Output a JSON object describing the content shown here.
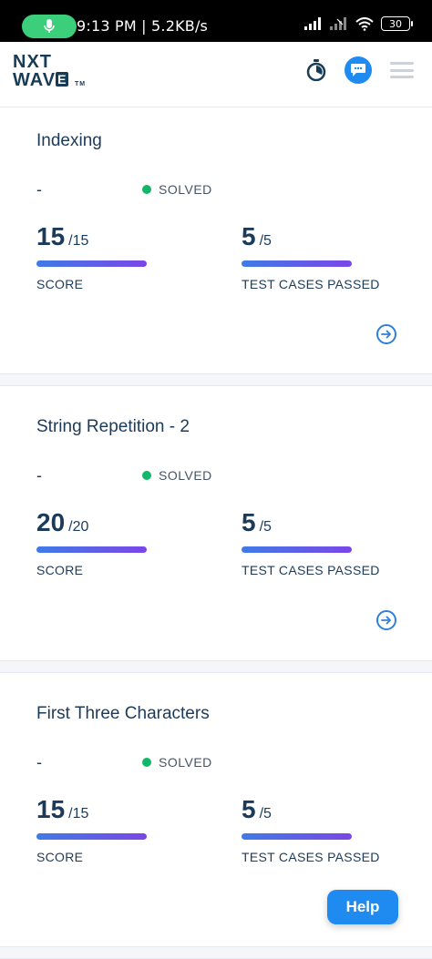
{
  "status_bar": {
    "time_speed": "9:13 PM | 5.2KB/s",
    "battery": "30"
  },
  "header": {
    "logo_line1": "NXT",
    "logo_line2a": "WAV",
    "logo_box": "E",
    "logo_tm": "TM"
  },
  "cards": [
    {
      "title": "Indexing",
      "dash": "-",
      "status": "SOLVED",
      "score": "15",
      "score_total": "/15",
      "score_label": "SCORE",
      "tests": "5",
      "tests_total": "/5",
      "tests_label": "TEST CASES PASSED"
    },
    {
      "title": "String Repetition - 2",
      "dash": "-",
      "status": "SOLVED",
      "score": "20",
      "score_total": "/20",
      "score_label": "SCORE",
      "tests": "5",
      "tests_total": "/5",
      "tests_label": "TEST CASES PASSED"
    },
    {
      "title": "First Three Characters",
      "dash": "-",
      "status": "SOLVED",
      "score": "15",
      "score_total": "/15",
      "score_label": "SCORE",
      "tests": "5",
      "tests_total": "/5",
      "tests_label": "TEST CASES PASSED"
    }
  ],
  "help_label": "Help",
  "colors": {
    "accent": "#1f8bf0",
    "solved_dot": "#12b76a",
    "heading": "#1c3a5a"
  }
}
